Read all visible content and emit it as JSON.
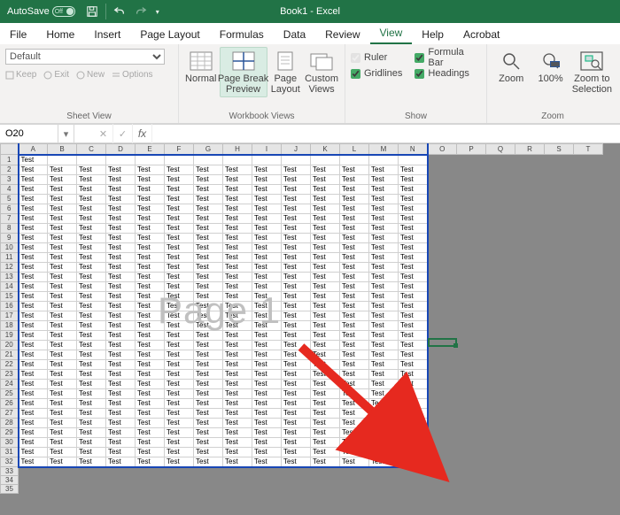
{
  "titlebar": {
    "autosave_label": "AutoSave",
    "autosave_state": "Off",
    "title": "Book1  -  Excel"
  },
  "tabs": {
    "items": [
      "File",
      "Home",
      "Insert",
      "Page Layout",
      "Formulas",
      "Data",
      "Review",
      "View",
      "Help",
      "Acrobat"
    ],
    "active_index": 7
  },
  "ribbon": {
    "sheet_view": {
      "dropdown_value": "Default",
      "keep": "Keep",
      "exit": "Exit",
      "new": "New",
      "options": "Options",
      "group_label": "Sheet View"
    },
    "workbook_views": {
      "normal": "Normal",
      "page_break": "Page Break\nPreview",
      "page_layout": "Page\nLayout",
      "custom_views": "Custom\nViews",
      "group_label": "Workbook Views"
    },
    "show": {
      "ruler": "Ruler",
      "gridlines": "Gridlines",
      "formula_bar": "Formula Bar",
      "headings": "Headings",
      "group_label": "Show"
    },
    "zoom": {
      "zoom": "Zoom",
      "hundred": "100%",
      "zoom_sel": "Zoom to\nSelection",
      "group_label": "Zoom"
    }
  },
  "fxbar": {
    "namebox": "O20",
    "formula": ""
  },
  "grid": {
    "cols": [
      "A",
      "B",
      "C",
      "D",
      "E",
      "F",
      "G",
      "H",
      "I",
      "J",
      "K",
      "L",
      "M",
      "N",
      "O",
      "P",
      "Q",
      "R",
      "S",
      "T"
    ],
    "row_count": 35,
    "data_rows": 32,
    "data_cols": 14,
    "cell_text": "Test",
    "row1_only_col1": true,
    "watermark": "Page 1",
    "selected_cell": "O20"
  },
  "chart_data": null
}
